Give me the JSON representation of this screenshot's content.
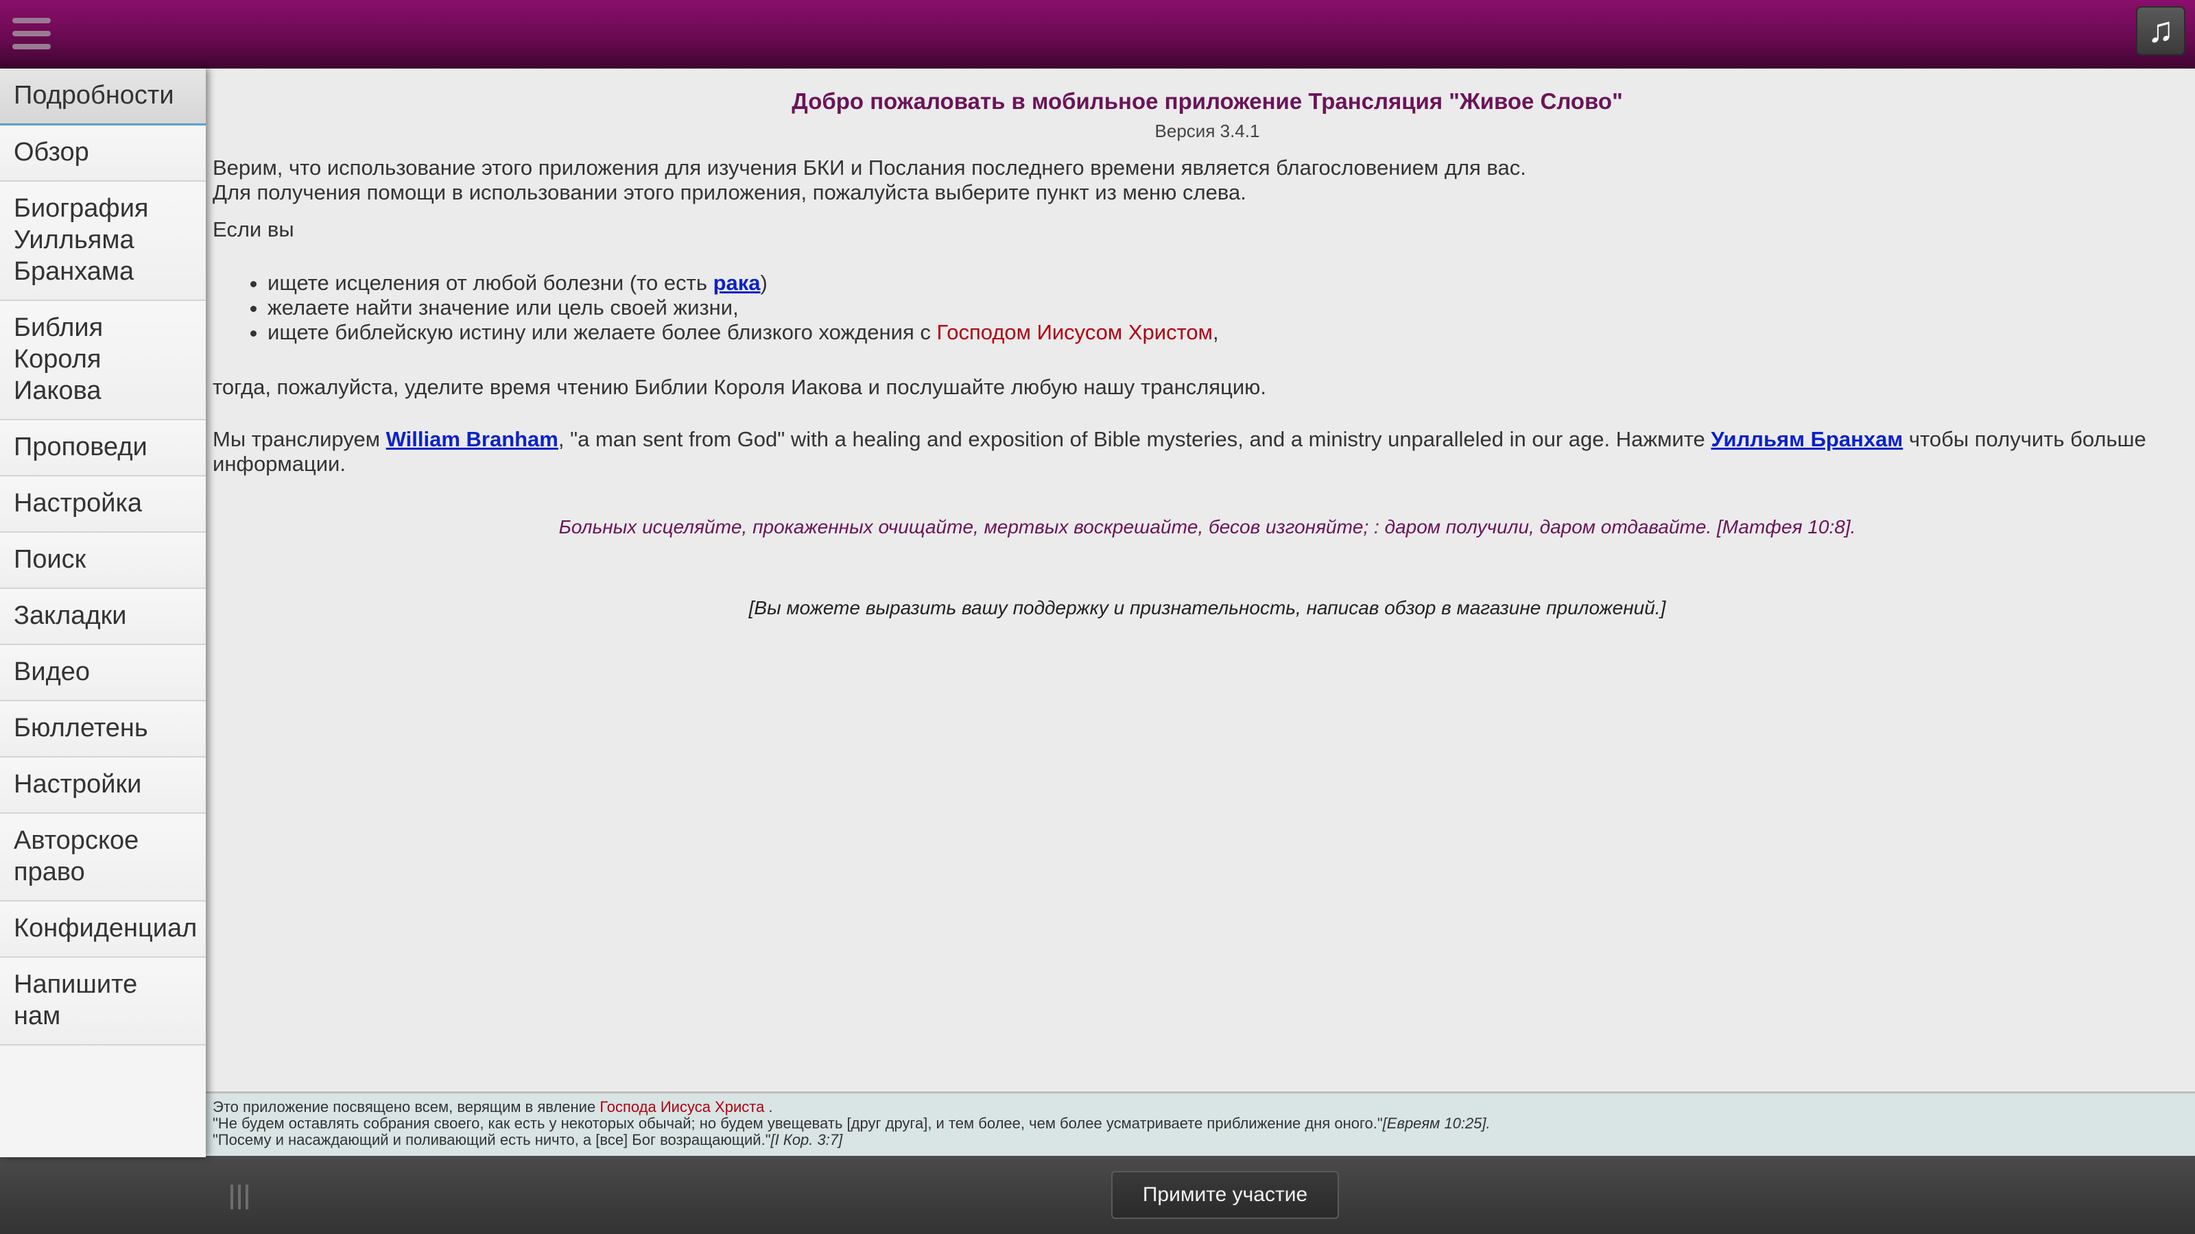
{
  "header": {
    "menu_icon": "hamburger-menu-icon",
    "music_icon": "music-note-icon",
    "music_glyph": "♫"
  },
  "sidebar": {
    "items": [
      {
        "label": "Подробности",
        "active": true
      },
      {
        "label": "Обзор"
      },
      {
        "label": "Биография Уилльяма Бранхама"
      },
      {
        "label": "Библия Короля Иакова"
      },
      {
        "label": "Проповеди"
      },
      {
        "label": "Настройка"
      },
      {
        "label": "Поиск"
      },
      {
        "label": "Закладки"
      },
      {
        "label": "Видео"
      },
      {
        "label": "Бюллетень"
      },
      {
        "label": "Настройки"
      },
      {
        "label": "Авторское право"
      },
      {
        "label": "Конфиденциал"
      },
      {
        "label": "Напишите нам"
      }
    ]
  },
  "main": {
    "title": "Добро пожаловать в мобильное приложение Трансляция \"Живое Слово\"",
    "version": "Версия 3.4.1",
    "intro_line1": "Верим, что использование этого приложения для изучения БКИ и Послания последнего времени является благословением для вас.",
    "intro_line2": "Для получения помощи в использовании этого приложения, пожалуйста выберите пункт из меню слева.",
    "if_you": "Если вы",
    "bullet1_pre": "ищете исцеления от любой болезни (то есть ",
    "bullet1_link": "рака",
    "bullet1_post": ")",
    "bullet2": "желаете найти значение или цель своей жизни,",
    "bullet3_pre": "ищете библейскую истину или желаете более близкого хождения с ",
    "bullet3_red": "Господом Иисусом Христом",
    "bullet3_post": ",",
    "then_text": "тогда, пожалуйста, уделите время чтению Библии Короля Иакова и послушайте любую нашу трансляцию.",
    "broadcast_pre": "Мы транслируем ",
    "broadcast_link1": "William Branham",
    "broadcast_mid": ", \"a man sent from God\" with a healing and exposition of Bible mysteries, and a ministry unparalleled in our age. Нажмите ",
    "broadcast_link2": "Уилльям Бранхам",
    "broadcast_post": " чтобы получить больше информации.",
    "quote": "Больных исцеляйте, прокаженных очищайте, мертвых воскрешайте, бесов изгоняйте; : даром получили, даром отдавайте. [Матфея 10:8].",
    "support": "[Вы можете выразить вашу поддержку и признательность, написав обзор в магазине приложений.]"
  },
  "footnote": {
    "line1_pre": "Это приложение посвящено всем, верящим в явление ",
    "line1_red": "Господа Иисуса Христа",
    "line1_post": " .",
    "line2": "\"Не будем оставлять собрания своего, как есть у некоторых обычай; но будем увещевать [друг друга], и тем более, чем более усматриваете приближение дня оного.\"",
    "line2_ref": "[Евреям 10:25].",
    "line3": "\"Посему и насаждающий и поливающий есть ничто, а [все] Бог возращающий.\"",
    "line3_ref": "[I Кор. 3:7]"
  },
  "bottombar": {
    "participate_label": "Примите участие"
  },
  "colors": {
    "header": "#7a0d5f",
    "title": "#6b1458",
    "link": "#0a22c8",
    "red_text": "#b00010"
  }
}
